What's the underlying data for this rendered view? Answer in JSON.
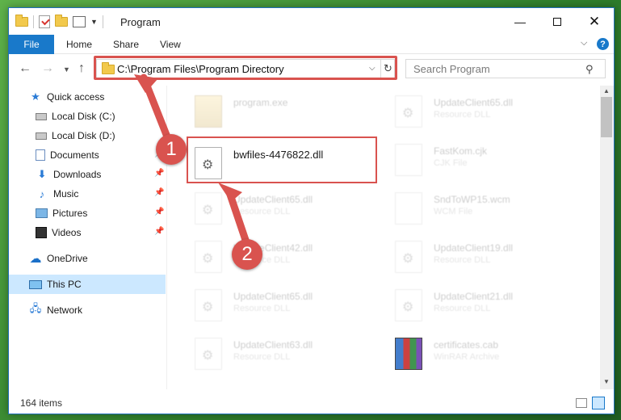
{
  "window": {
    "title": "Program",
    "minimize_icon": "minimize-icon",
    "maximize_icon": "maximize-icon",
    "close_icon": "close-icon"
  },
  "ribbon": {
    "file_label": "File",
    "tabs": [
      "Home",
      "Share",
      "View"
    ]
  },
  "address_bar": {
    "path": "C:\\Program Files\\Program Directory",
    "search_placeholder": "Search Program"
  },
  "sidebar": {
    "items": [
      {
        "label": "Quick access",
        "icon": "star-icon"
      },
      {
        "label": "Local Disk (C:)",
        "icon": "drive-icon"
      },
      {
        "label": "Local Disk (D:)",
        "icon": "drive-icon"
      },
      {
        "label": "Documents",
        "icon": "documents-icon"
      },
      {
        "label": "Downloads",
        "icon": "download-icon"
      },
      {
        "label": "Music",
        "icon": "music-icon"
      },
      {
        "label": "Pictures",
        "icon": "pictures-icon"
      },
      {
        "label": "Videos",
        "icon": "videos-icon"
      },
      {
        "label": "OneDrive",
        "icon": "cloud-icon"
      },
      {
        "label": "This PC",
        "icon": "computer-icon"
      },
      {
        "label": "Network",
        "icon": "network-icon"
      }
    ]
  },
  "files": [
    {
      "name": "program.exe",
      "type": ""
    },
    {
      "name": "UpdateClient65.dll",
      "type": "Resource DLL"
    },
    {
      "name": "bwfiles-4476822.dll",
      "type": ""
    },
    {
      "name": "FastKom.cjk",
      "type": "CJK File"
    },
    {
      "name": "UpdateClient65.dll",
      "type": "Resource DLL"
    },
    {
      "name": "SndToWP15.wcm",
      "type": "WCM File"
    },
    {
      "name": "UpdateClient42.dll",
      "type": "Resource DLL"
    },
    {
      "name": "UpdateClient19.dll",
      "type": "Resource DLL"
    },
    {
      "name": "UpdateClient65.dll",
      "type": "Resource DLL"
    },
    {
      "name": "UpdateClient21.dll",
      "type": "Resource DLL"
    },
    {
      "name": "UpdateClient63.dll",
      "type": "Resource DLL"
    },
    {
      "name": "certificates.cab",
      "type": "WinRAR Archive"
    }
  ],
  "status": {
    "item_count": "164 items"
  },
  "annotations": {
    "step1": "1",
    "step2": "2",
    "highlight_color": "#d9534f"
  },
  "colors": {
    "accent": "#1979ca",
    "selection": "#cce8ff"
  }
}
